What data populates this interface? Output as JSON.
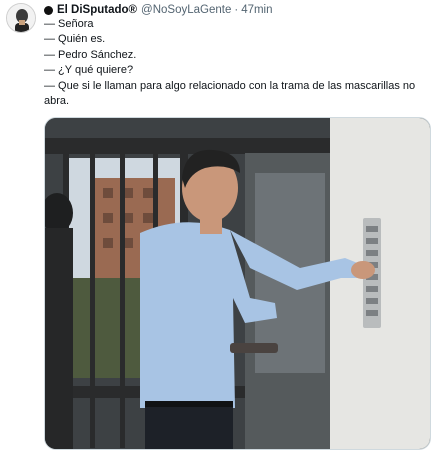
{
  "tweet": {
    "display_name": "El DiSputado®",
    "handle": "@NoSoyLaGente",
    "separator": "·",
    "time": "47min",
    "lines": [
      "— Señora",
      "— Quién es.",
      "— Pedro Sánchez.",
      "— ¿Y qué quiere?",
      "— Que si le llaman para algo relacionado con la trama de las mascarillas no abra."
    ]
  },
  "media": {
    "description_icon": "photo-image"
  },
  "colors": {
    "text_primary": "#0f1419",
    "text_secondary": "#536471",
    "border": "#cfd9de"
  }
}
